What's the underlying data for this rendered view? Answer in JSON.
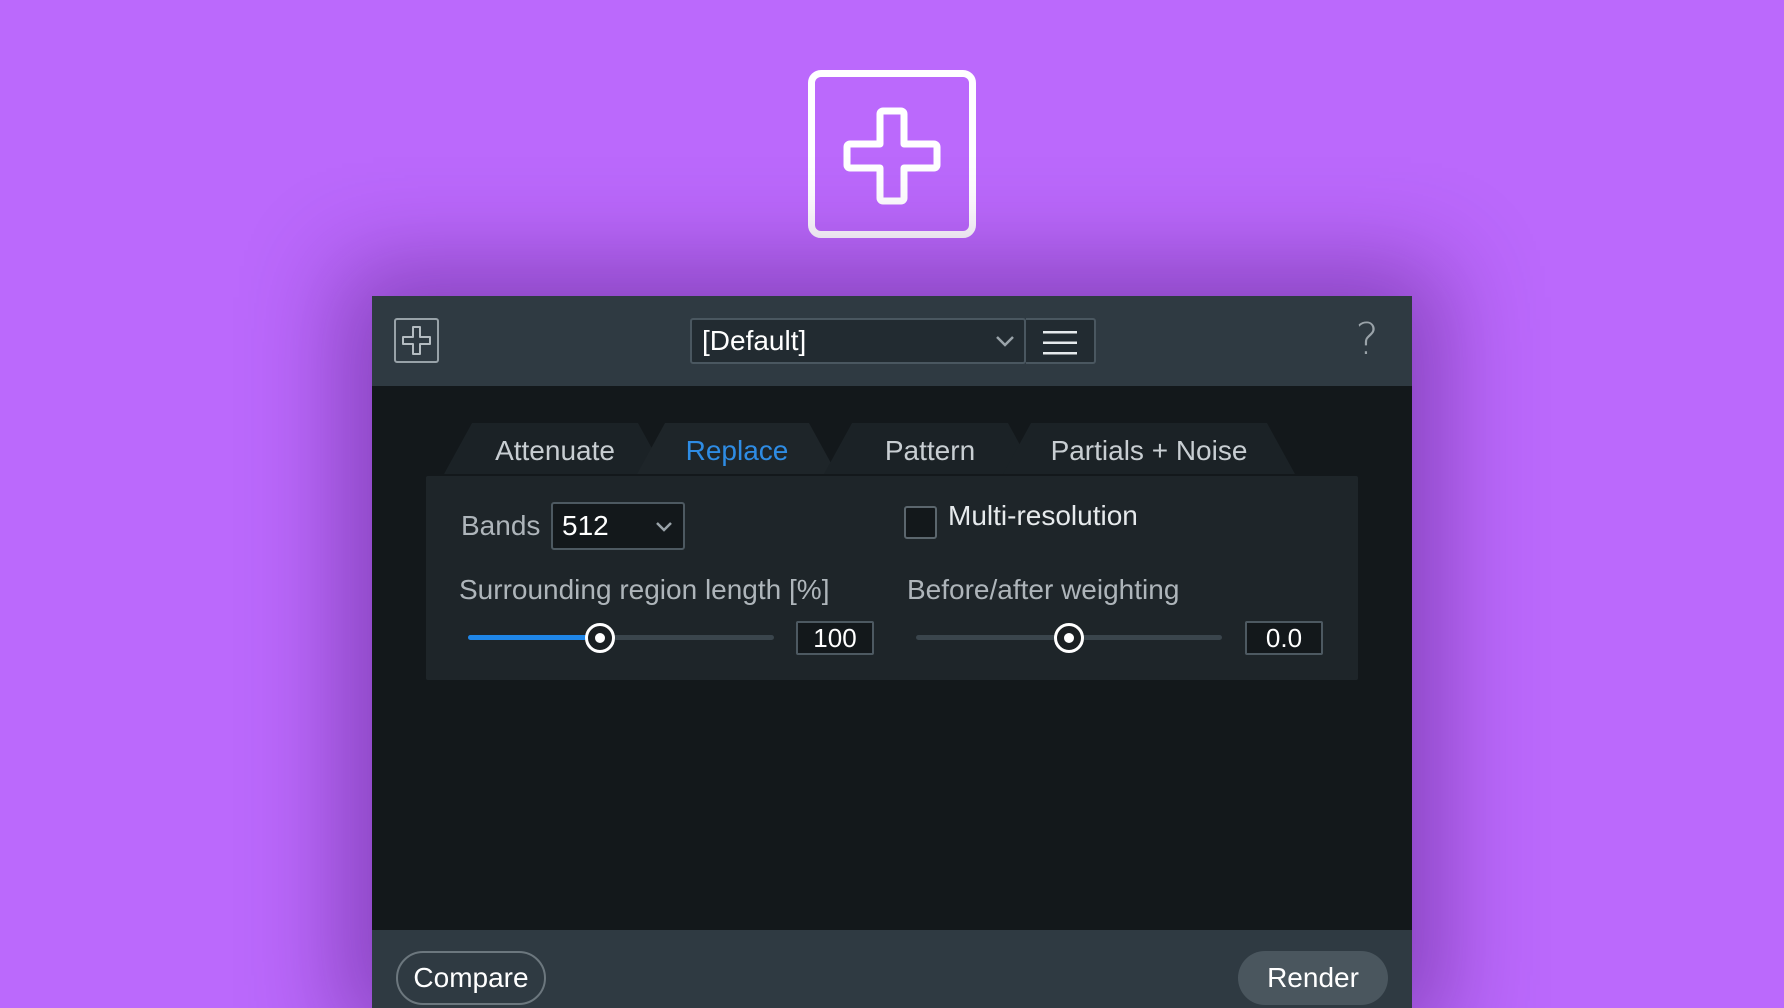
{
  "hero": {
    "icon": "plus-square-icon"
  },
  "header": {
    "logo_icon": "plus-square-icon",
    "preset_value": "[Default]",
    "preset_chevron_icon": "chevron-down-icon",
    "menu_icon": "hamburger-menu-icon",
    "help_label": "?"
  },
  "tabs": [
    {
      "label": "Attenuate",
      "active": false
    },
    {
      "label": "Replace",
      "active": true
    },
    {
      "label": "Pattern",
      "active": false
    },
    {
      "label": "Partials + Noise",
      "active": false
    }
  ],
  "replace": {
    "bands_label": "Bands",
    "bands_value": "512",
    "multi_resolution_label": "Multi-resolution",
    "multi_resolution_checked": false,
    "surrounding_label": "Surrounding region length [%]",
    "surrounding_value": "100",
    "surrounding_fraction": 0.43,
    "weighting_label": "Before/after weighting",
    "weighting_value": "0.0",
    "weighting_fraction": 0.5
  },
  "footer": {
    "compare_label": "Compare",
    "render_label": "Render"
  },
  "colors": {
    "background": "#bb69fc",
    "accent": "#2e8ce4",
    "slider_fill": "#1f86e8"
  }
}
